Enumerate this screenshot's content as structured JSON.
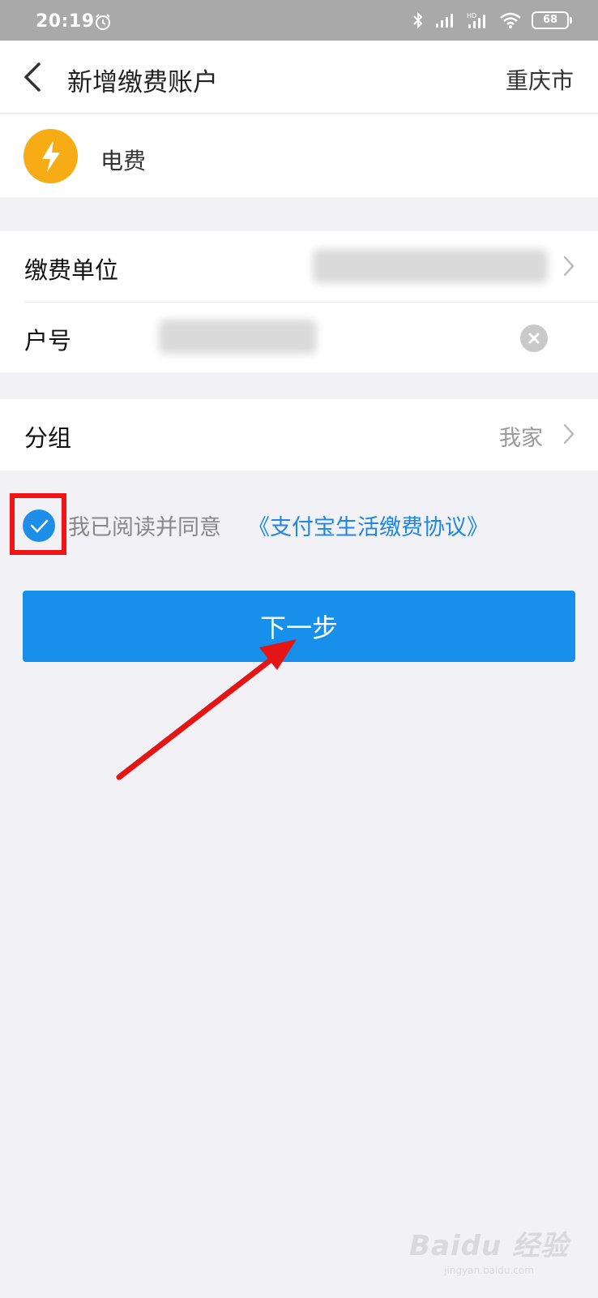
{
  "status_bar": {
    "time": "20:19",
    "battery": "68"
  },
  "nav": {
    "title": "新增缴费账户",
    "city": "重庆市"
  },
  "service": {
    "name": "电费",
    "icon": "lightning-icon",
    "icon_color": "#f7ac16"
  },
  "form": {
    "unit_label": "缴费单位",
    "account_label": "户号"
  },
  "group": {
    "label": "分组",
    "value": "我家"
  },
  "agreement": {
    "checked": true,
    "text": "我已阅读并同意",
    "link": "《支付宝生活缴费协议》"
  },
  "next_button": {
    "label": "下一步"
  },
  "watermark": {
    "logo": "Baidu 经验",
    "url": "jingyan.baidu.com"
  },
  "colors": {
    "accent": "#1690ea",
    "link": "#1e86e6",
    "highlight": "#f01414"
  }
}
